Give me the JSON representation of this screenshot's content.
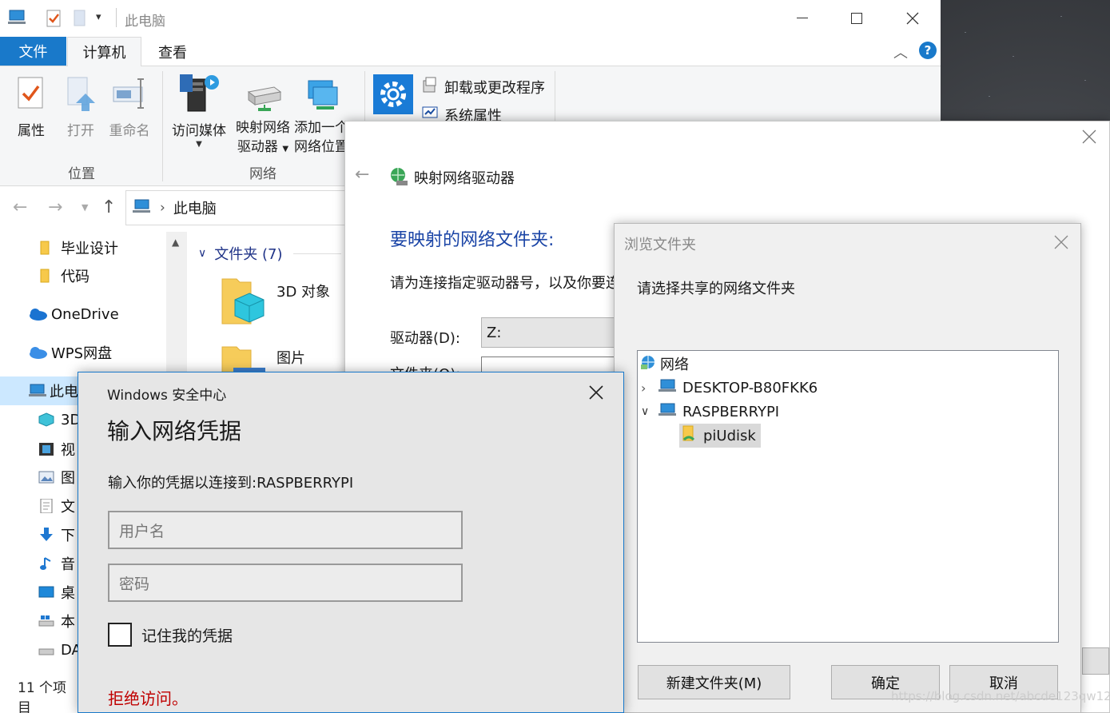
{
  "explorer": {
    "title": "此电脑",
    "menu": {
      "file": "文件",
      "computer": "计算机",
      "view": "查看"
    },
    "ribbon": {
      "properties": "属性",
      "open": "打开",
      "rename": "重命名",
      "group_location": "位置",
      "access_media": "访问媒体",
      "map_drive_line1": "映射网络",
      "map_drive_line2": "驱动器",
      "add_location_line1": "添加一个",
      "add_location_line2": "网络位置",
      "group_network": "网络",
      "uninstall": "卸载或更改程序",
      "system_properties": "系统属性",
      "open_settings": "打开"
    },
    "address": "此电脑",
    "nav": {
      "graduation": "毕业设计",
      "code": "代码",
      "onedrive": "OneDrive",
      "wps": "WPS网盘",
      "this_pc": "此电",
      "objects3d": "3D",
      "videos": "视",
      "pictures": "图",
      "documents": "文",
      "downloads": "下",
      "music": "音",
      "desktop": "桌",
      "local": "本",
      "data": "DA"
    },
    "content": {
      "folders_header": "文件夹 (7)",
      "item_3d": "3D 对象",
      "item_pictures": "图片"
    },
    "status": "11 个项目"
  },
  "map_dialog": {
    "title": "映射网络驱动器",
    "heading": "要映射的网络文件夹:",
    "description": "请为连接指定驱动器号，以及你要连",
    "drive_label": "驱动器(D):",
    "drive_value": "Z:",
    "folder_label": "文件夹(O):"
  },
  "browse_dialog": {
    "title": "浏览文件夹",
    "prompt": "请选择共享的网络文件夹",
    "tree": {
      "network": "网络",
      "desktop": "DESKTOP-B80FKK6",
      "raspberry": "RASPBERRYPI",
      "share": "piUdisk"
    },
    "new_folder": "新建文件夹(M)",
    "ok": "确定",
    "cancel": "取消"
  },
  "security_dialog": {
    "app": "Windows 安全中心",
    "heading": "输入网络凭据",
    "subtitle": "输入你的凭据以连接到:RASPBERRYPI",
    "username_placeholder": "用户名",
    "password_placeholder": "密码",
    "remember": "记住我的凭据",
    "error": "拒绝访问。",
    "error_color": "#c00000"
  },
  "watermark": "https://blog.csdn.net/abcde123qw123"
}
